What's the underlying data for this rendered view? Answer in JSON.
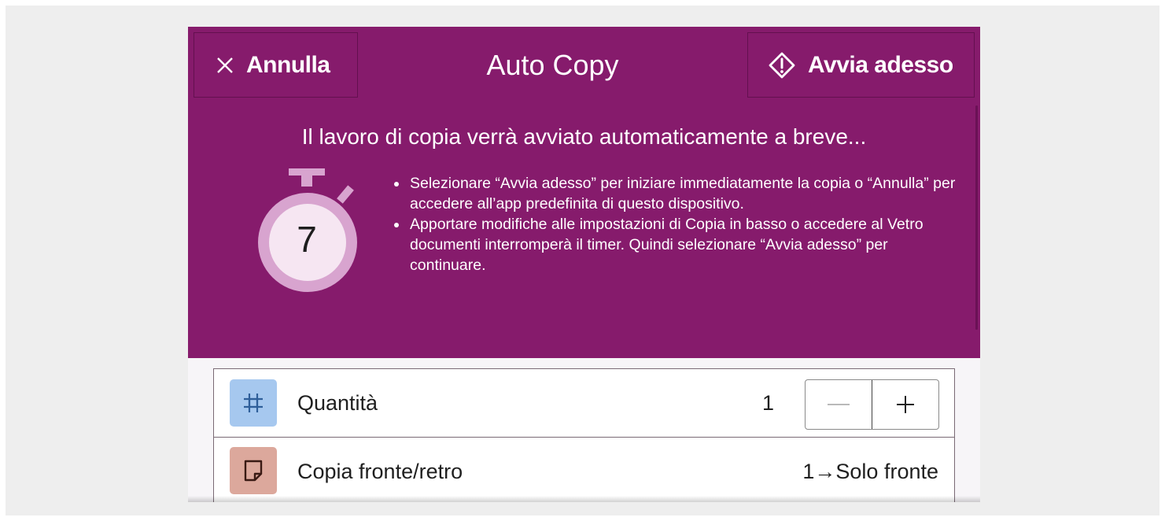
{
  "header": {
    "cancel_label": "Annulla",
    "title": "Auto Copy",
    "start_label": "Avvia adesso"
  },
  "notice": {
    "heading": "Il lavoro di copia verrà avviato automaticamente a breve...",
    "countdown": "7",
    "bullets": [
      "Selezionare “Avvia adesso” per iniziare immediatamente la copia o “Annulla” per accedere all’app predefinita di questo dispositivo.",
      "Apportare modifiche alle impostazioni di Copia in basso o accedere al Vetro documenti interromperà il timer. Quindi selezionare “Avvia adesso” per continuare."
    ]
  },
  "settings": {
    "quantity": {
      "label": "Quantità",
      "value": "1",
      "minus": "—",
      "plus": "+"
    },
    "duplex": {
      "label": "Copia fronte/retro",
      "value": "1→Solo fronte"
    }
  },
  "icons": {
    "cancel": "close-icon",
    "start": "start-diamond-icon",
    "timer": "stopwatch-icon",
    "quantity": "quantity-grid-icon",
    "duplex": "page-icon"
  },
  "colors": {
    "accent": "#861b6c",
    "quantity_icon_bg": "#a6c8ef",
    "duplex_icon_bg": "#dca89c",
    "timer_face": "#f6e6f2",
    "timer_ring": "#d8a4cf"
  }
}
